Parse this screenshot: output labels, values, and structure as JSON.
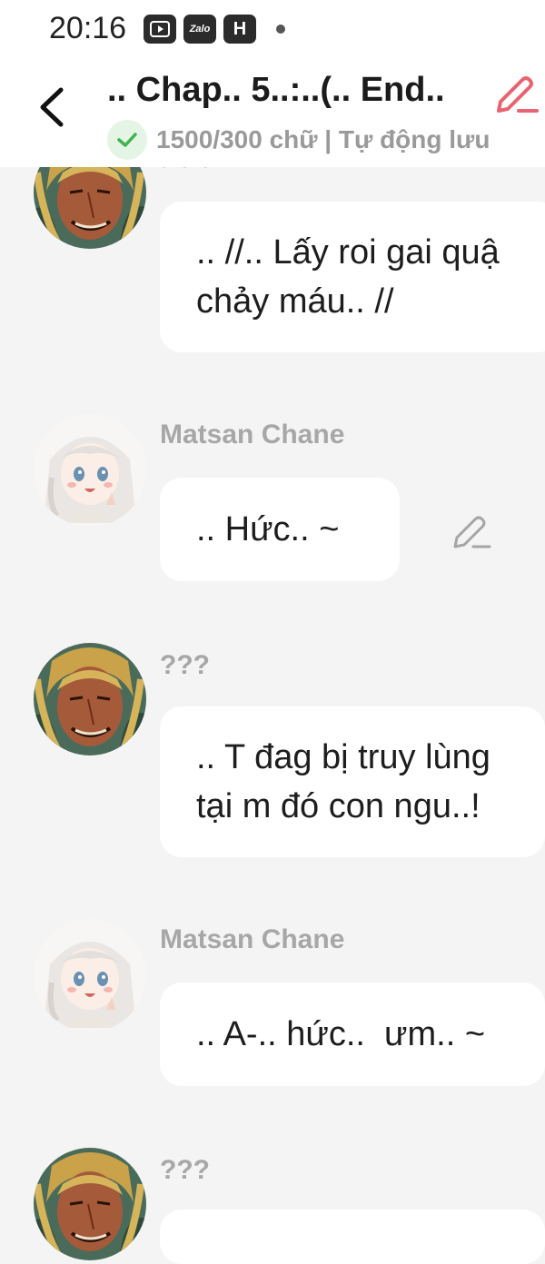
{
  "status_bar": {
    "time": "20:16",
    "app_icons": [
      "video-app-icon",
      "zalo-icon",
      "h-app-icon"
    ],
    "zalo_label": "Zalo",
    "h_label": "H"
  },
  "header": {
    "title": ".. Chap.. 5..:..(.. End..",
    "save_status": "1500/300 chữ | Tự động lưu"
  },
  "colors": {
    "accent_edit": "#e8636f",
    "saved_check": "#3fb34f"
  },
  "messages": [
    {
      "id": "msg-1",
      "sender": "",
      "sender_top": "• • •",
      "avatar": "villain-avatar",
      "text": ".. //.. Lấy roi gai quậ\nchảy máu.. //"
    },
    {
      "id": "msg-2",
      "sender": "Matsan Chane",
      "avatar": "matsan-avatar",
      "text": ".. Hức.. ~"
    },
    {
      "id": "msg-3",
      "sender": "???",
      "avatar": "villain-avatar",
      "text": ".. T đag bị truy lùng\ntại m đó con ngu..!"
    },
    {
      "id": "msg-4",
      "sender": "Matsan Chane",
      "avatar": "matsan-avatar",
      "text": ".. A-.. hức..  ưm.. ~"
    },
    {
      "id": "msg-5",
      "sender": "???",
      "avatar": "villain-avatar",
      "text": ""
    }
  ]
}
